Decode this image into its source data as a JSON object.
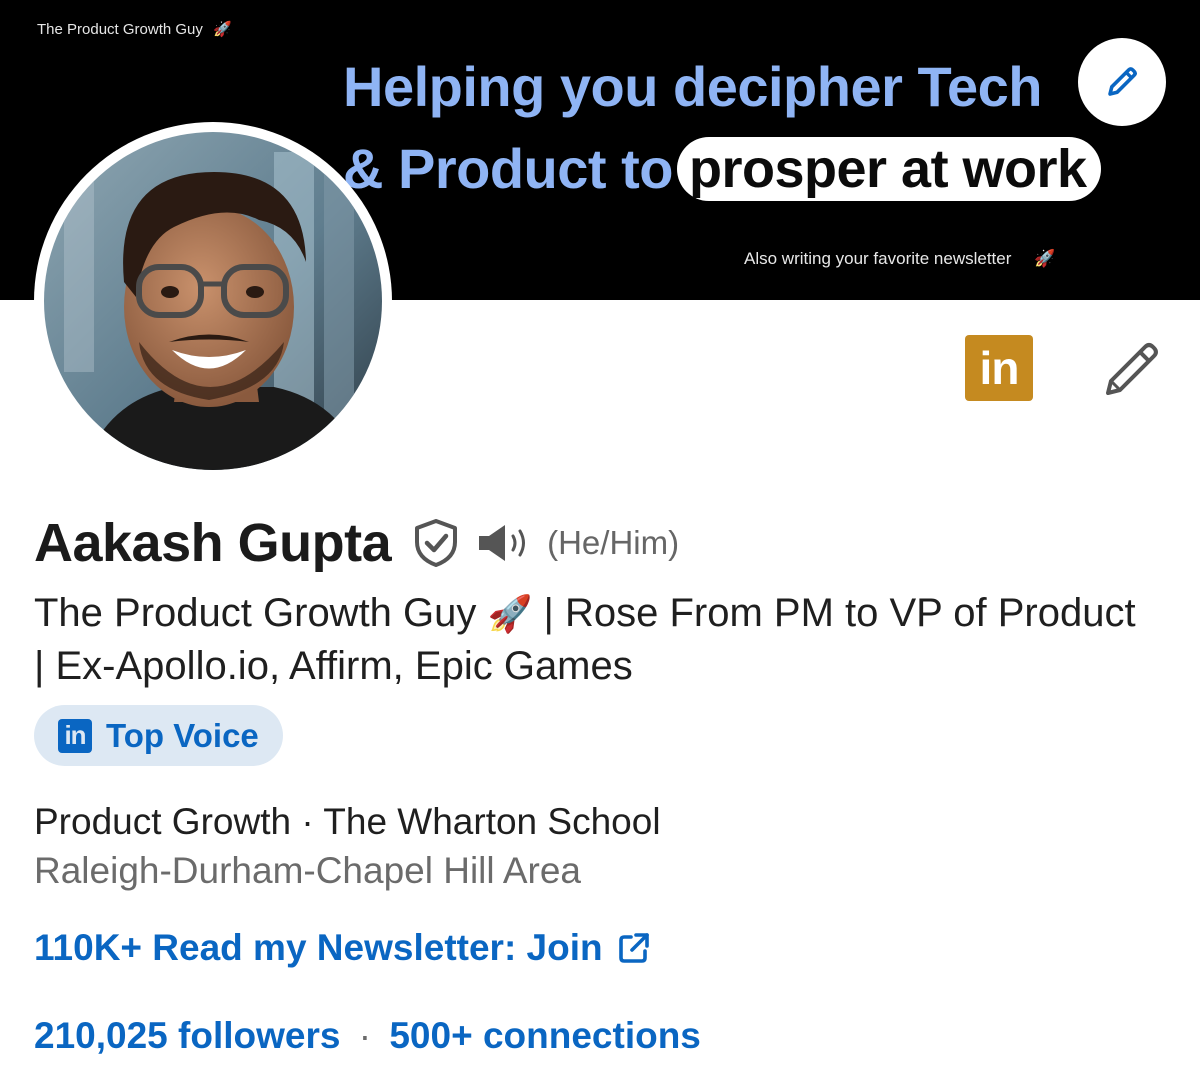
{
  "banner": {
    "brand": "The Product Growth Guy",
    "brand_icon": "🚀",
    "line1": "Helping you decipher Tech",
    "line2_lead": "& Product to",
    "line2_highlight": "prosper at work",
    "tagline": "Also writing your favorite newsletter",
    "tagline_icon": "🚀"
  },
  "profile": {
    "name": "Aakash Gupta",
    "pronouns": "(He/Him)",
    "headline_part1": "The Product Growth Guy",
    "headline_emoji": "🚀",
    "headline_part2": " | Rose From PM to VP of Product | Ex-Apollo.io, Affirm, Epic Games",
    "badge_logo": "in",
    "badge_label": "Top Voice",
    "education": "Product Growth · The Wharton School",
    "location": "Raleigh-Durham-Chapel Hill Area",
    "newsletter_link": "110K+ Read my Newsletter: Join",
    "followers": "210,025 followers",
    "separator": "·",
    "connections": "500+ connections"
  },
  "actions": {
    "linkedin_badge": "in"
  },
  "icons": {
    "banner_edit": "pencil-icon",
    "profile_edit": "pencil-icon",
    "verified": "shield-check-icon",
    "pronunciation": "speaker-icon",
    "external_link": "external-link-icon"
  },
  "colors": {
    "banner_bg": "#000000",
    "banner_text": "#8fb4f4",
    "link_blue": "#0a66c2",
    "badge_bg": "#dde8f3",
    "linkedin_badge_bg": "#c58a20"
  }
}
